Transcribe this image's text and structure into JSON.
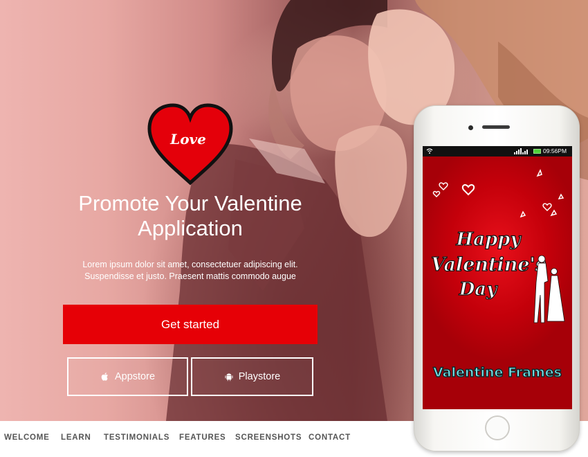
{
  "hero": {
    "badge_text": "Love",
    "title_line1": "Promote Your Valentine",
    "title_line2": "Application",
    "desc_line1": "Lorem ipsum dolor sit amet, consectetuer adipiscing elit.",
    "desc_line2": "Suspendisse et justo. Praesent mattis commodo augue",
    "cta_label": "Get started",
    "appstore_label": "Appstore",
    "playstore_label": "Playstore",
    "icons": {
      "appstore": "apple-icon",
      "playstore": "android-icon"
    }
  },
  "phone": {
    "status_time": "09:56PM",
    "art_heading1": "Happy",
    "art_heading2": "Valentine's",
    "art_heading3": "Day",
    "art_caption": "Valentine Frames"
  },
  "nav": {
    "items": [
      {
        "label": "WELCOME"
      },
      {
        "label": "LEARN"
      },
      {
        "label": "TESTIMONIALS"
      },
      {
        "label": "FEATURES"
      },
      {
        "label": "SCREENSHOTS"
      },
      {
        "label": "CONTACT"
      }
    ]
  },
  "colors": {
    "accent_red": "#e60006",
    "hero_tint": "#d08a87",
    "nav_text": "#555555",
    "caption_cyan": "#7fe9ef"
  }
}
